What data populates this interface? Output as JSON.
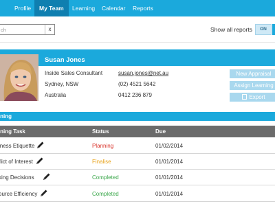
{
  "nav": {
    "items": [
      {
        "label": "Profile"
      },
      {
        "label": "My Team"
      },
      {
        "label": "Learning"
      },
      {
        "label": "Calendar"
      },
      {
        "label": "Reports"
      }
    ],
    "active": "My Team"
  },
  "toolbar": {
    "search_placeholder": "ch",
    "search_clear": "x",
    "show_all_label": "Show all reports",
    "toggle_on_label": "ON"
  },
  "profile": {
    "name": "Susan Jones",
    "title": "Inside Sales Consultant",
    "location": "Sydney, NSW",
    "country": "Australia",
    "email": "susan.jones@net.au",
    "phone": "(02) 4521 5642",
    "mobile": "0412 236 879",
    "buttons": {
      "new_appraisal": "New Appraisal",
      "assign_learning": "Assign Learning",
      "export": "Export"
    }
  },
  "learning": {
    "section_title": "rning",
    "headers": {
      "task": "rning Task",
      "status": "Status",
      "due": "Due"
    },
    "rows": [
      {
        "task": "iness Etiquette",
        "status": "Planning",
        "due": "01/02/2014"
      },
      {
        "task": "flict of Interest",
        "status": "Finalise",
        "due": "01/01/2014"
      },
      {
        "task": "king Decisions",
        "status": "Completed",
        "due": "01/01/2014"
      },
      {
        "task": "ource Efficiency",
        "status": "Completed",
        "due": "01/01/2014"
      }
    ]
  },
  "colors": {
    "accent": "#1ba9dc",
    "nav_active": "#0f7fb0",
    "table_header": "#6b6b6b",
    "status_planning": "#d9342b",
    "status_finalise": "#e8a41e",
    "status_completed": "#3aa74a"
  }
}
